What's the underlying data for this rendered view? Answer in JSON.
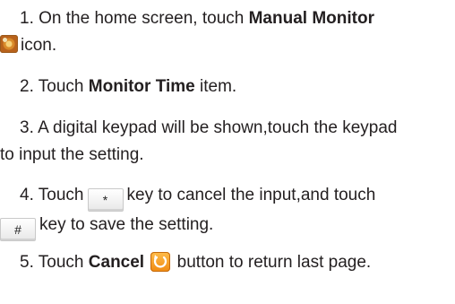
{
  "steps": [
    {
      "num": "1.",
      "pre": "On the home screen, touch",
      "bold": "Manual Monitor",
      "icon": "manual-monitor-icon",
      "post": "icon."
    },
    {
      "num": "2.",
      "pre": "Touch",
      "bold": "Monitor Time",
      "post": "item."
    },
    {
      "num": "3.",
      "line1": "A digital keypad will be shown,touch the keypad",
      "line2": "to input the setting."
    },
    {
      "num": "4.",
      "pre": "Touch",
      "key_star": "*",
      "mid": "key to cancel the input,and touch",
      "key_hash": "#",
      "post": "key to save the setting."
    },
    {
      "num": "5.",
      "pre": "Touch",
      "bold": "Cancel",
      "icon": "cancel-return-icon",
      "post": "button to return last page."
    }
  ]
}
